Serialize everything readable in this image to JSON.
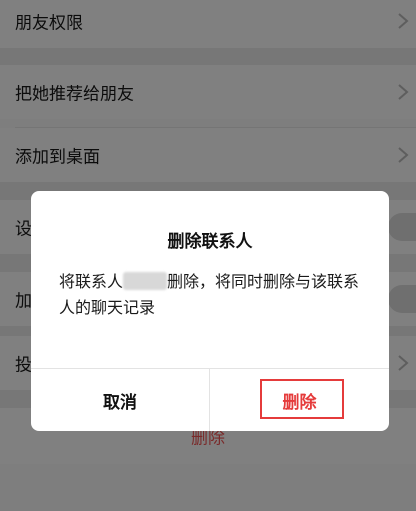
{
  "background_rows": {
    "friend_permissions": "朋友权限",
    "recommend": "把她推荐给朋友",
    "add_desktop": "添加到桌面",
    "set_partial": "设",
    "add_partial": "加",
    "complain_partial": "投",
    "delete_label": "删除"
  },
  "dialog": {
    "title": "删除联系人",
    "message_prefix": "将联系人",
    "message_suffix": "删除，将同时删除与该联系人的聊天记录",
    "cancel_label": "取消",
    "confirm_label": "删除"
  },
  "colors": {
    "accent_red": "#e53b3b",
    "overlay_gray": "#7e7e7e"
  }
}
